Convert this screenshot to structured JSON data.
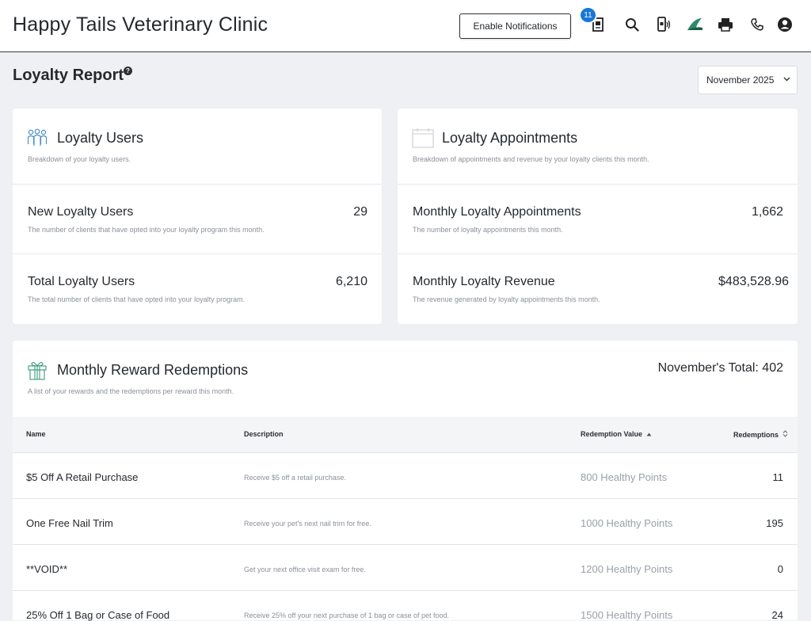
{
  "header": {
    "clinic_name": "Happy Tails Veterinary Clinic",
    "notifications_button": "Enable Notifications",
    "badge_count": "11",
    "icons": [
      "catalog-icon",
      "search-icon",
      "mobile-sound-icon",
      "leaf-logo-icon",
      "printer-icon",
      "phone-icon",
      "account-icon"
    ]
  },
  "page": {
    "title": "Loyalty Report",
    "help": "?",
    "month_select": "November 2025"
  },
  "loyalty_users": {
    "title": "Loyalty Users",
    "subtitle": "Breakdown of your loyalty users.",
    "metrics": [
      {
        "title": "New Loyalty Users",
        "desc": "The number of clients that have opted into your loyalty program this month.",
        "value": "29"
      },
      {
        "title": "Total Loyalty Users",
        "desc": "The total number of clients that have opted into your loyalty program.",
        "value": "6,210"
      }
    ]
  },
  "loyalty_appointments": {
    "title": "Loyalty Appointments",
    "subtitle": "Breakdown of appointments and revenue by your loyalty clients this month.",
    "metrics": [
      {
        "title": "Monthly Loyalty Appointments",
        "desc": "The number of loyalty appointments this month.",
        "value": "1,662"
      },
      {
        "title": "Monthly Loyalty Revenue",
        "desc": "The revenue generated by loyalty appointments this month.",
        "value": "$483,528.96"
      }
    ]
  },
  "redemptions": {
    "title": "Monthly Reward Redemptions",
    "subtitle": "A list of your rewards and the redemptions per reward this month.",
    "total": "November's Total: 402",
    "columns": [
      "Name",
      "Description",
      "Redemption Value",
      "Redemptions"
    ],
    "rows": [
      {
        "name": "$5 Off A Retail Purchase",
        "desc": "Receive $5 off a retail purchase.",
        "value": "800 Healthy Points",
        "redemptions": "11"
      },
      {
        "name": "One Free Nail Trim",
        "desc": "Receive your pet's next nail trim for free.",
        "value": "1000 Healthy Points",
        "redemptions": "195"
      },
      {
        "name": "**VOID**",
        "desc": "Get your next office visit exam for free.",
        "value": "1200 Healthy Points",
        "redemptions": "0"
      },
      {
        "name": "25% Off 1 Bag or Case of Food",
        "desc": "Receive 25% off your next purchase of 1 bag or case of pet food.",
        "value": "1500 Healthy Points",
        "redemptions": "24"
      }
    ]
  }
}
